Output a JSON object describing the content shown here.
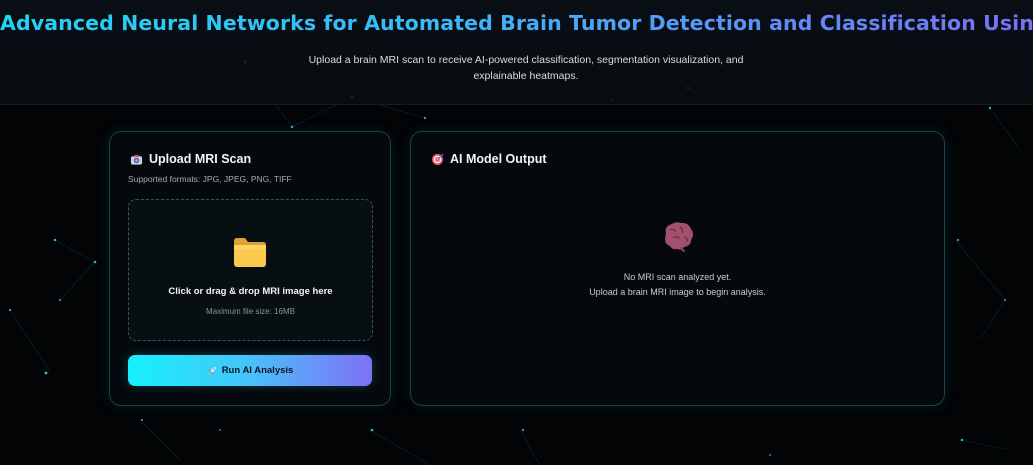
{
  "header": {
    "title": "Advanced Neural Networks for Automated Brain Tumor Detection and Classification Using MRI",
    "subtitle": "Upload a brain MRI scan to receive AI-powered classification, segmentation visualization, and explainable heatmaps."
  },
  "upload_panel": {
    "title": "Upload MRI Scan",
    "icon": "camera-icon",
    "formats": "Supported formats: JPG, JPEG, PNG, TIFF",
    "dropzone": {
      "icon": "folder-icon",
      "text": "Click or drag & drop MRI image here",
      "subtext": "Maximum file size: 16MB"
    },
    "run_button": {
      "label": "Run AI Analysis",
      "icon": "rocket-icon"
    }
  },
  "output_panel": {
    "title": "AI Model Output",
    "icon": "target-icon",
    "empty_icon": "brain-icon",
    "empty_line1": "No MRI scan analyzed yet.",
    "empty_line2": "Upload a brain MRI image to begin analysis."
  },
  "colors": {
    "background": "#020406",
    "accent_cyan": "#17f0fb",
    "accent_violet": "#7c72f4",
    "card_border": "#17424a"
  }
}
